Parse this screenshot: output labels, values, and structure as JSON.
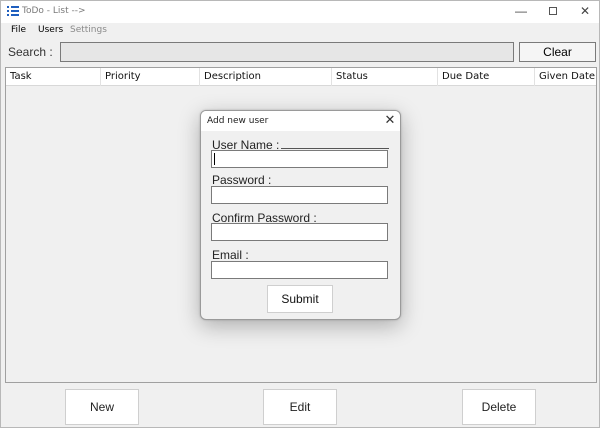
{
  "window": {
    "title": "ToDo - List -->",
    "min_glyph": "—",
    "close_glyph": "✕"
  },
  "menu": {
    "items": [
      {
        "label": "File",
        "enabled": true
      },
      {
        "label": "Users",
        "enabled": true
      },
      {
        "label": "Settings",
        "enabled": false
      }
    ]
  },
  "search": {
    "label": "Search :",
    "value": "",
    "clear_label": "Clear"
  },
  "grid": {
    "columns": [
      "Task",
      "Priority",
      "Description",
      "Status",
      "Due Date",
      "Given Date"
    ],
    "rows": []
  },
  "actions": {
    "new_label": "New",
    "edit_label": "Edit",
    "delete_label": "Delete"
  },
  "dialog": {
    "title": "Add new user",
    "close_glyph": "✕",
    "fields": [
      {
        "label": "User Name :",
        "value": ""
      },
      {
        "label": "Password :",
        "value": ""
      },
      {
        "label": "Confirm Password :",
        "value": ""
      },
      {
        "label": "Email :",
        "value": ""
      }
    ],
    "submit_label": "Submit"
  },
  "colors": {
    "app_icon": "#1f5fbf",
    "window_bg": "#f0f0f0",
    "titlebar_bg": "#ffffff"
  }
}
